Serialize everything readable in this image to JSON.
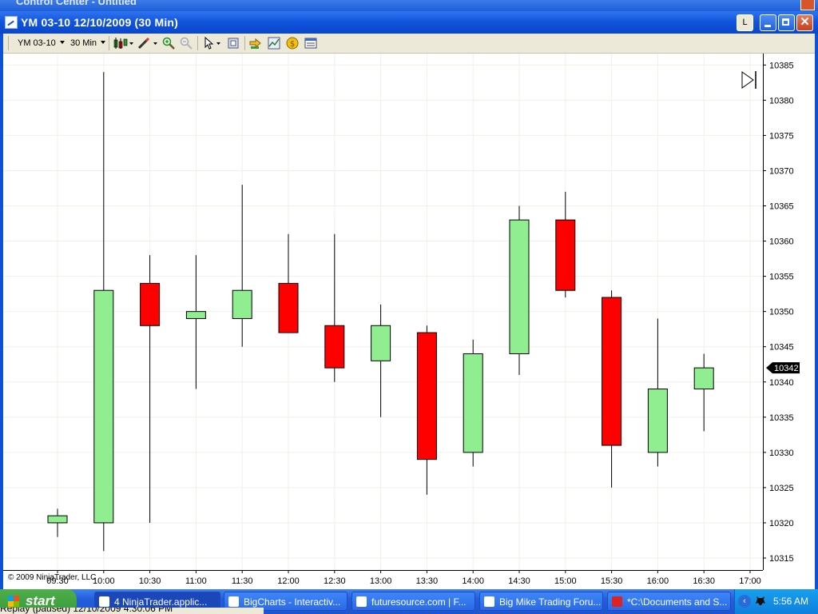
{
  "background_window": {
    "title": "Control Center - Untitled"
  },
  "window": {
    "title": "YM 03-10  12/10/2009 (30 Min)",
    "link_button": "L",
    "close_glyph": "✕"
  },
  "toolbar": {
    "instrument": "YM 03-10",
    "interval": "30 Min",
    "icons": [
      "candlestick-style-icon",
      "drawing-pencil-icon",
      "zoom-in-icon",
      "zoom-out-icon",
      "pointer-icon",
      "properties-icon",
      "data-box-icon",
      "indicators-icon",
      "strategies-icon",
      "chart-properties-icon"
    ]
  },
  "chart_data": {
    "type": "candlestick",
    "title": "",
    "xlabel": "",
    "ylabel": "",
    "ylim": [
      10314,
      10388
    ],
    "y_ticks": [
      10315,
      10320,
      10325,
      10330,
      10335,
      10340,
      10345,
      10350,
      10355,
      10360,
      10365,
      10370,
      10375,
      10380,
      10385
    ],
    "x_ticks": [
      "09:30",
      "10:00",
      "10:30",
      "11:00",
      "11:30",
      "12:00",
      "12:30",
      "13:00",
      "13:30",
      "14:00",
      "14:30",
      "15:00",
      "15:30",
      "16:00",
      "16:30",
      "17:00"
    ],
    "up_color": "#90ee90",
    "down_color": "#ff0000",
    "grid": true,
    "candles": [
      {
        "time": "09:30",
        "open": 10320,
        "high": 10322,
        "low": 10318,
        "close": 10321
      },
      {
        "time": "10:00",
        "open": 10320,
        "high": 10384,
        "low": 10316,
        "close": 10353
      },
      {
        "time": "10:30",
        "open": 10354,
        "high": 10358,
        "low": 10320,
        "close": 10348
      },
      {
        "time": "11:00",
        "open": 10349,
        "high": 10358,
        "low": 10339,
        "close": 10350
      },
      {
        "time": "11:30",
        "open": 10349,
        "high": 10368,
        "low": 10345,
        "close": 10353
      },
      {
        "time": "12:00",
        "open": 10354,
        "high": 10361,
        "low": 10347,
        "close": 10347
      },
      {
        "time": "12:30",
        "open": 10348,
        "high": 10361,
        "low": 10340,
        "close": 10342
      },
      {
        "time": "13:00",
        "open": 10343,
        "high": 10351,
        "low": 10335,
        "close": 10348
      },
      {
        "time": "13:30",
        "open": 10347,
        "high": 10348,
        "low": 10324,
        "close": 10329
      },
      {
        "time": "14:00",
        "open": 10330,
        "high": 10346,
        "low": 10328,
        "close": 10344
      },
      {
        "time": "14:30",
        "open": 10344,
        "high": 10365,
        "low": 10341,
        "close": 10363
      },
      {
        "time": "15:00",
        "open": 10363,
        "high": 10367,
        "low": 10352,
        "close": 10353
      },
      {
        "time": "15:30",
        "open": 10352,
        "high": 10353,
        "low": 10325,
        "close": 10331
      },
      {
        "time": "16:00",
        "open": 10330,
        "high": 10349,
        "low": 10328,
        "close": 10339
      },
      {
        "time": "16:30",
        "open": 10339,
        "high": 10344,
        "low": 10333,
        "close": 10342
      }
    ],
    "last_price_label": "10342",
    "last_price": 10342,
    "copyright": "© 2009 NinjaTrader, LLC"
  },
  "taskbar": {
    "start_label": "start",
    "tasks": [
      {
        "label": "4 NinjaTrader.applic...",
        "icon": "ninjatrader-icon",
        "active": true
      },
      {
        "label": "BigCharts - Interactiv...",
        "icon": "ie-icon",
        "active": false
      },
      {
        "label": "futuresource.com | F...",
        "icon": "ie-icon",
        "active": false
      },
      {
        "label": "Big Mike Trading Foru...",
        "icon": "ie-icon",
        "active": false
      },
      {
        "label": "*C:\\Documents and S...",
        "icon": "notepad-icon",
        "active": false
      }
    ],
    "clock": "5:56 AM"
  },
  "status_bar": {
    "text": "Replay (paused) 12/10/2009 4:30:06 PM"
  }
}
